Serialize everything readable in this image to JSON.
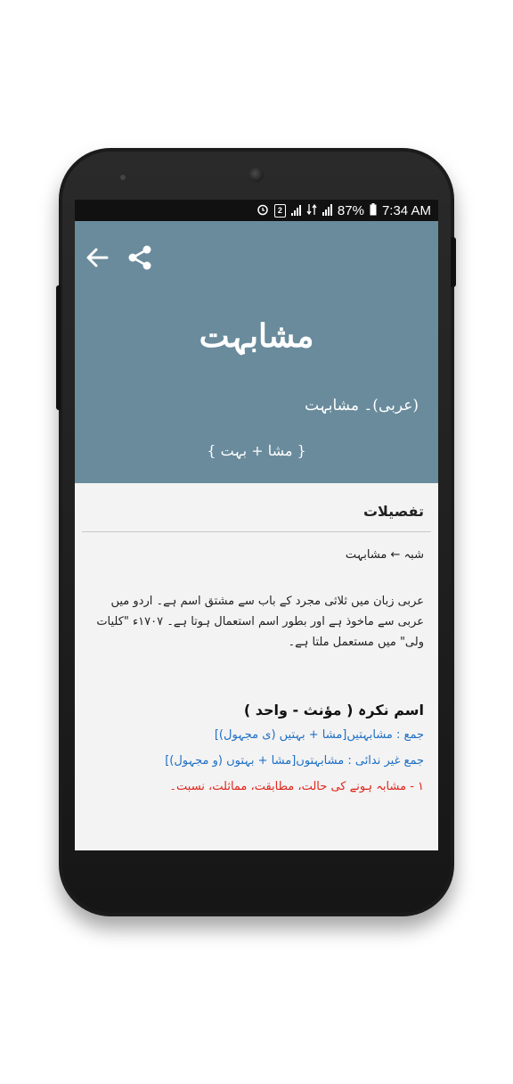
{
  "status_bar": {
    "sim_label": "2",
    "battery": "87%",
    "time": "7:34 AM"
  },
  "header": {
    "title": "مشابہت",
    "origin": "(عربی)۔ مشابہت",
    "breakdown": "{ مشا + بہت }"
  },
  "details": {
    "section_title": "تفصیلات",
    "word_family": "شبہ ← مشابہت",
    "paragraph": "عربی زبان میں ثلاثی مجرد کے باب سے مشتق اسم ہے۔ اردو میں عربی سے ماخوذ ہے اور بطور اسم استعمال ہوتا ہے۔ ۱۷۰۷ء \"کلیات ولی\" میں مستعمل ملتا ہے۔",
    "part_of_speech": "اسم نکرہ ( مؤنث - واحد )",
    "plural": "جمع : مشابہتیں[مشا + بہتیں (ی مجہول)]",
    "plural_oblique": "جمع غیر ندائی : مشابہتوں[مشا + بہتوں (و مجہول)]",
    "meaning_1": "۱ - مشابہ ہونے کی حالت، مطابقت، مماثلت، نسبت۔"
  },
  "colors": {
    "header_bg": "#698b9c",
    "plural_text": "#1e6fc4",
    "meaning_text": "#e0261c"
  },
  "icons": [
    "alarm-icon",
    "sim-icon",
    "signal-icon",
    "data-icon",
    "battery-icon",
    "back-arrow-icon",
    "share-icon"
  ]
}
